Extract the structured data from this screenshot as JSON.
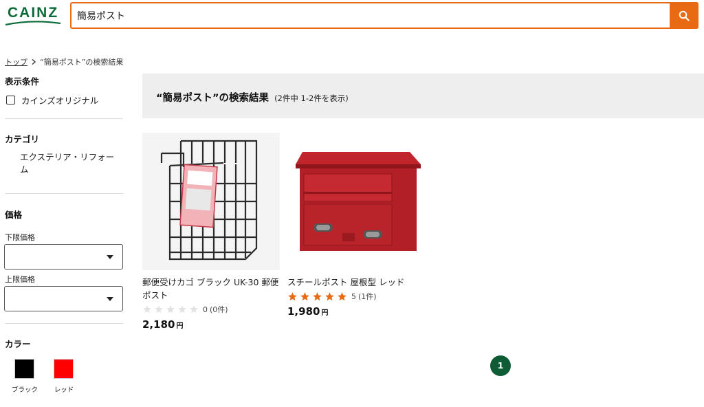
{
  "header": {
    "logo_text": "CAINZ",
    "search_value": "簡易ポスト",
    "brand_color": "#0a6b38",
    "accent_color": "#e86a12",
    "search_icon": "search-icon"
  },
  "breadcrumb": {
    "top": "トップ",
    "current": "“簡易ポスト”の検索結果"
  },
  "sidebar": {
    "display_conditions": {
      "heading": "表示条件",
      "checkbox_label": "カインズオリジナル",
      "checked": false
    },
    "category": {
      "heading": "カテゴリ",
      "item": "エクステリア・リフォーム"
    },
    "price": {
      "heading": "価格",
      "min_label": "下限価格",
      "max_label": "上限価格"
    },
    "color": {
      "heading": "カラー",
      "swatches": [
        {
          "label": "ブラック",
          "color": "#000000"
        },
        {
          "label": "レッド",
          "color": "#ff0000"
        }
      ]
    }
  },
  "main": {
    "results_title": "“簡易ポスト”の検索結果",
    "results_count": "(2件中 1-2件を表示)",
    "products": [
      {
        "name": "郵便受けカゴ ブラック UK-30 郵便ポスト",
        "rating": 0,
        "rating_text": "0",
        "review_count": "(0件)",
        "price": "2,180",
        "currency": "円"
      },
      {
        "name": "スチールポスト 屋根型 レッド",
        "rating": 5,
        "rating_text": "5",
        "review_count": "(1件)",
        "price": "1,980",
        "currency": "円"
      }
    ],
    "pagination": {
      "current_page": "1"
    }
  }
}
